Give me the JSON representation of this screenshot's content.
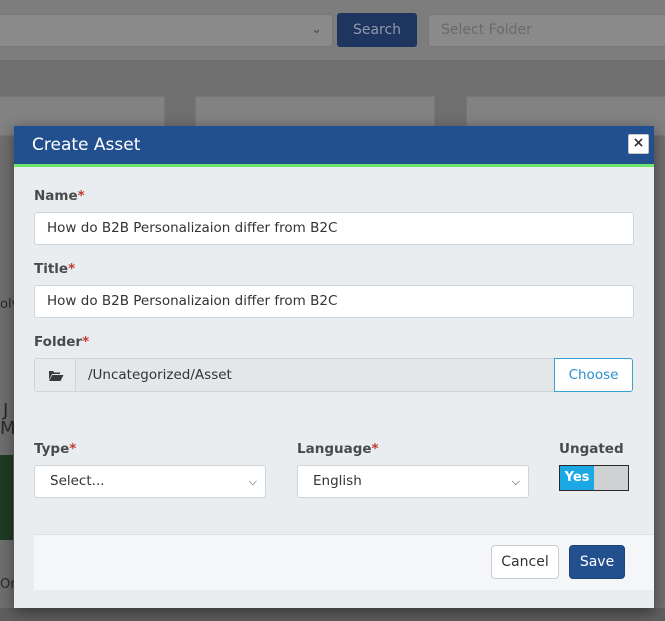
{
  "background": {
    "search_label": "Search",
    "folder_placeholder": "Select Folder",
    "fragments": [
      "olv",
      "J",
      "M",
      "Or"
    ]
  },
  "modal": {
    "title": "Create Asset",
    "close_label": "×",
    "name": {
      "label": "Name",
      "required_mark": "*",
      "value": "How do B2B Personalizaion differ from B2C"
    },
    "title_field": {
      "label": "Title",
      "required_mark": "*",
      "value": "How do B2B Personalizaion differ from B2C"
    },
    "folder": {
      "label": "Folder",
      "required_mark": "*",
      "value": "/Uncategorized/Asset",
      "choose_label": "Choose"
    },
    "type": {
      "label": "Type",
      "required_mark": "*",
      "selected": "Select..."
    },
    "language": {
      "label": "Language",
      "required_mark": "*",
      "selected": "English"
    },
    "ungated": {
      "label": "Ungated",
      "state_label": "Yes",
      "on": true
    },
    "footer": {
      "cancel_label": "Cancel",
      "save_label": "Save"
    }
  },
  "colors": {
    "header": "#22508f",
    "accent": "#6ee46b",
    "toggle_on": "#1ba8e4",
    "required": "#c23a2e"
  },
  "icons": {
    "folder": "folder-open-icon",
    "dropdown": "chevron-down-icon",
    "close": "close-icon"
  }
}
